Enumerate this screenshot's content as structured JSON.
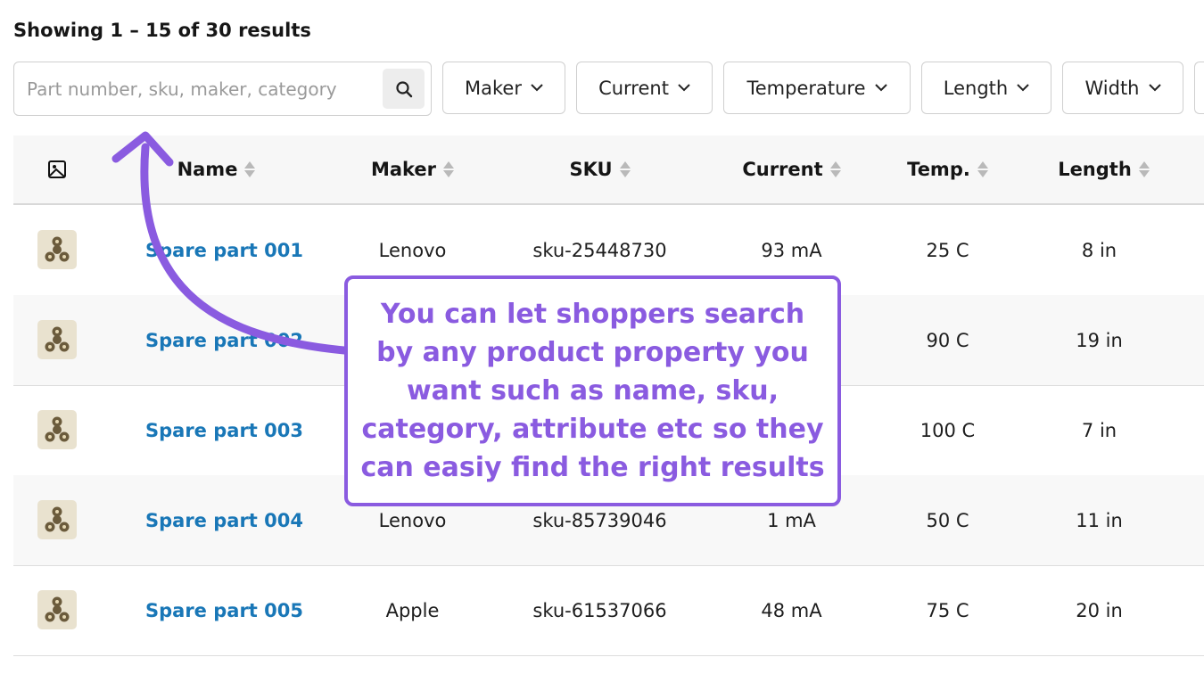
{
  "results": {
    "summary": "Showing 1 – 15 of 30 results"
  },
  "search": {
    "placeholder": "Part number, sku, maker, category",
    "value": ""
  },
  "filters": [
    "Maker",
    "Current",
    "Temperature",
    "Length",
    "Width"
  ],
  "table": {
    "headers": [
      "Name",
      "Maker",
      "SKU",
      "Current",
      "Temp.",
      "Length"
    ],
    "rows": [
      {
        "name": "Spare part 001",
        "maker": "Lenovo",
        "sku": "sku-25448730",
        "current": "93 mA",
        "temp": "25 C",
        "length": "8 in"
      },
      {
        "name": "Spare part 002",
        "maker": "",
        "sku": "",
        "current": "",
        "temp": "90 C",
        "length": "19 in"
      },
      {
        "name": "Spare part 003",
        "maker": "",
        "sku": "",
        "current": "",
        "temp": "100 C",
        "length": "7 in"
      },
      {
        "name": "Spare part 004",
        "maker": "Lenovo",
        "sku": "sku-85739046",
        "current": "1 mA",
        "temp": "50 C",
        "length": "11 in"
      },
      {
        "name": "Spare part 005",
        "maker": "Apple",
        "sku": "sku-61537066",
        "current": "48 mA",
        "temp": "75 C",
        "length": "20 in"
      }
    ]
  },
  "callout": {
    "text": "You can let shoppers search by any product property you want such as name, sku, category, attribute etc so they can easiy find the right results",
    "color": "#8a5be0"
  },
  "icons": {
    "search": "search-icon",
    "chevron": "chevron-down-icon",
    "image": "image-icon",
    "sort": "sort-icon",
    "thumbnail": "fidget-spinner-thumbnail"
  },
  "colors": {
    "link": "#1977b7",
    "accent": "#8a5be0"
  }
}
